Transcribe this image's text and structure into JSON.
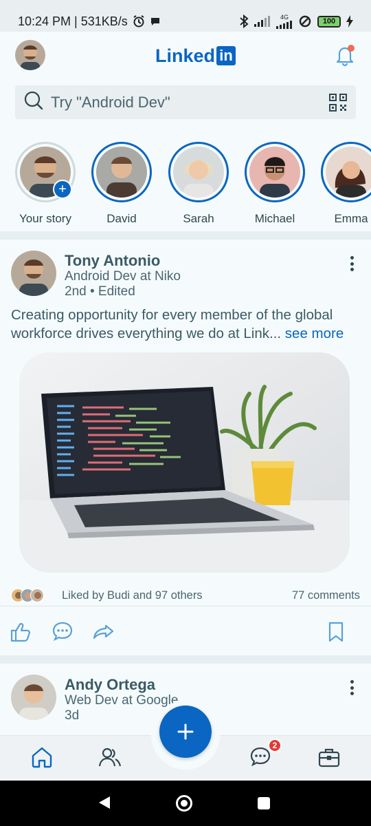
{
  "status_bar": {
    "time_speed": "10:24 PM | 531KB/s",
    "network": "4G",
    "battery": "100"
  },
  "header": {
    "logo_text": "Linked",
    "logo_in": "in"
  },
  "search": {
    "placeholder": "Try \"Android Dev\""
  },
  "stories": [
    {
      "name": "Your story",
      "self": true
    },
    {
      "name": "David"
    },
    {
      "name": "Sarah"
    },
    {
      "name": "Michael"
    },
    {
      "name": "Emma"
    }
  ],
  "posts": [
    {
      "author": "Tony Antonio",
      "title": "Android Dev at Niko",
      "meta": "2nd • Edited",
      "text": "Creating opportunity for every member of the global workforce drives everything we do at Link...",
      "see_more": "see more",
      "likes": "Liked by Budi and 97 others",
      "comments": "77 comments"
    },
    {
      "author": "Andy Ortega",
      "title": "Web Dev at Google",
      "meta": "3d"
    }
  ],
  "bottom_nav": {
    "messages_badge": "2"
  },
  "colors": {
    "brand": "#0a66c2",
    "text": "#3b5a66",
    "badge": "#e53935"
  }
}
